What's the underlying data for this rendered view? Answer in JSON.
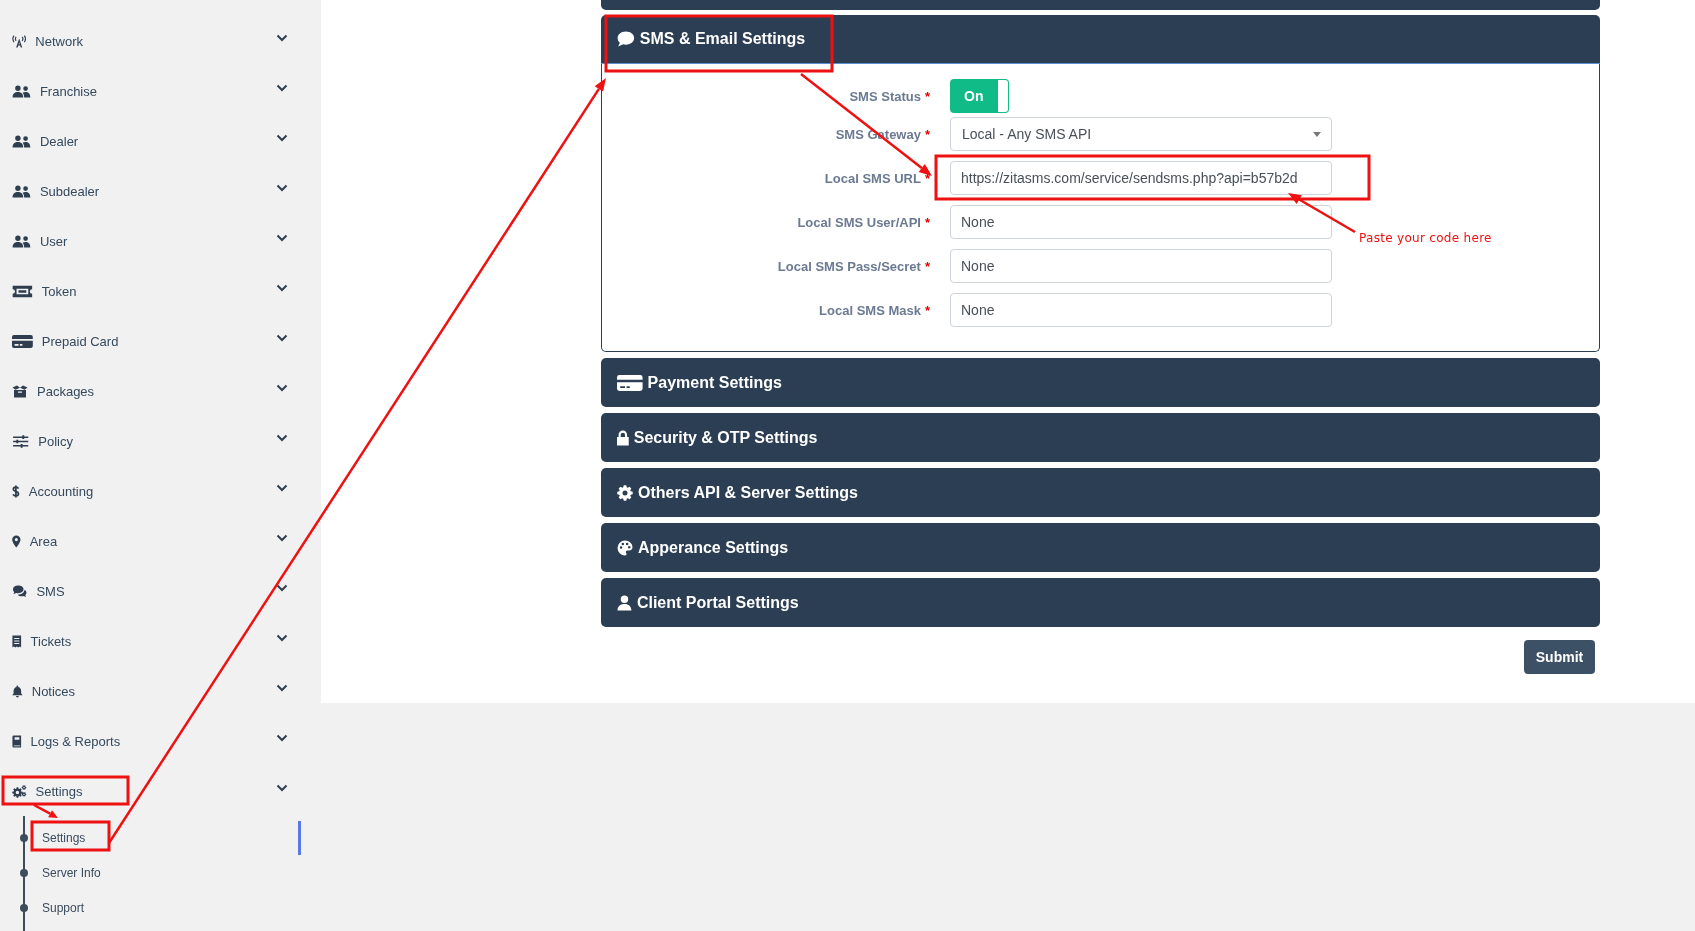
{
  "sidebar": {
    "items": [
      {
        "label": "Network"
      },
      {
        "label": "Franchise"
      },
      {
        "label": "Dealer"
      },
      {
        "label": "Subdealer"
      },
      {
        "label": "User"
      },
      {
        "label": "Token"
      },
      {
        "label": "Prepaid Card"
      },
      {
        "label": "Packages"
      },
      {
        "label": "Policy"
      },
      {
        "label": "Accounting"
      },
      {
        "label": "Area"
      },
      {
        "label": "SMS"
      },
      {
        "label": "Tickets"
      },
      {
        "label": "Notices"
      },
      {
        "label": "Logs & Reports"
      },
      {
        "label": "Settings",
        "children": [
          {
            "label": "Settings",
            "selected": true
          },
          {
            "label": "Server Info",
            "selected": false
          },
          {
            "label": "Support",
            "selected": false
          }
        ]
      }
    ]
  },
  "panels": [
    {
      "title": "SMS & Email Settings",
      "expanded": true,
      "fields": [
        {
          "kind": "toggle",
          "label": "SMS Status",
          "required_mark": "*",
          "on": true,
          "value": "On"
        },
        {
          "kind": "select",
          "label": "SMS Gateway",
          "required_mark": "*",
          "value": "Local - Any SMS API"
        },
        {
          "kind": "text",
          "label": "Local SMS URL",
          "required_mark": "*",
          "value": "https://zitasms.com/service/sendsms.php?api=b57b2d"
        },
        {
          "kind": "text",
          "label": "Local SMS User/API",
          "required_mark": "*",
          "value": "None"
        },
        {
          "kind": "text",
          "label": "Local SMS Pass/Secret",
          "required_mark": "*",
          "value": "None"
        },
        {
          "kind": "text",
          "label": "Local SMS Mask",
          "required_mark": "*",
          "value": "None"
        }
      ]
    },
    {
      "title": "Payment Settings",
      "expanded": false
    },
    {
      "title": "Security & OTP Settings",
      "expanded": false
    },
    {
      "title": "Others API & Server Settings",
      "expanded": false
    },
    {
      "title": "Apperance Settings",
      "expanded": false
    },
    {
      "title": "Client Portal Settings",
      "expanded": false
    }
  ],
  "submit": "Submit",
  "annotation": {
    "note": "Paste your code here"
  }
}
